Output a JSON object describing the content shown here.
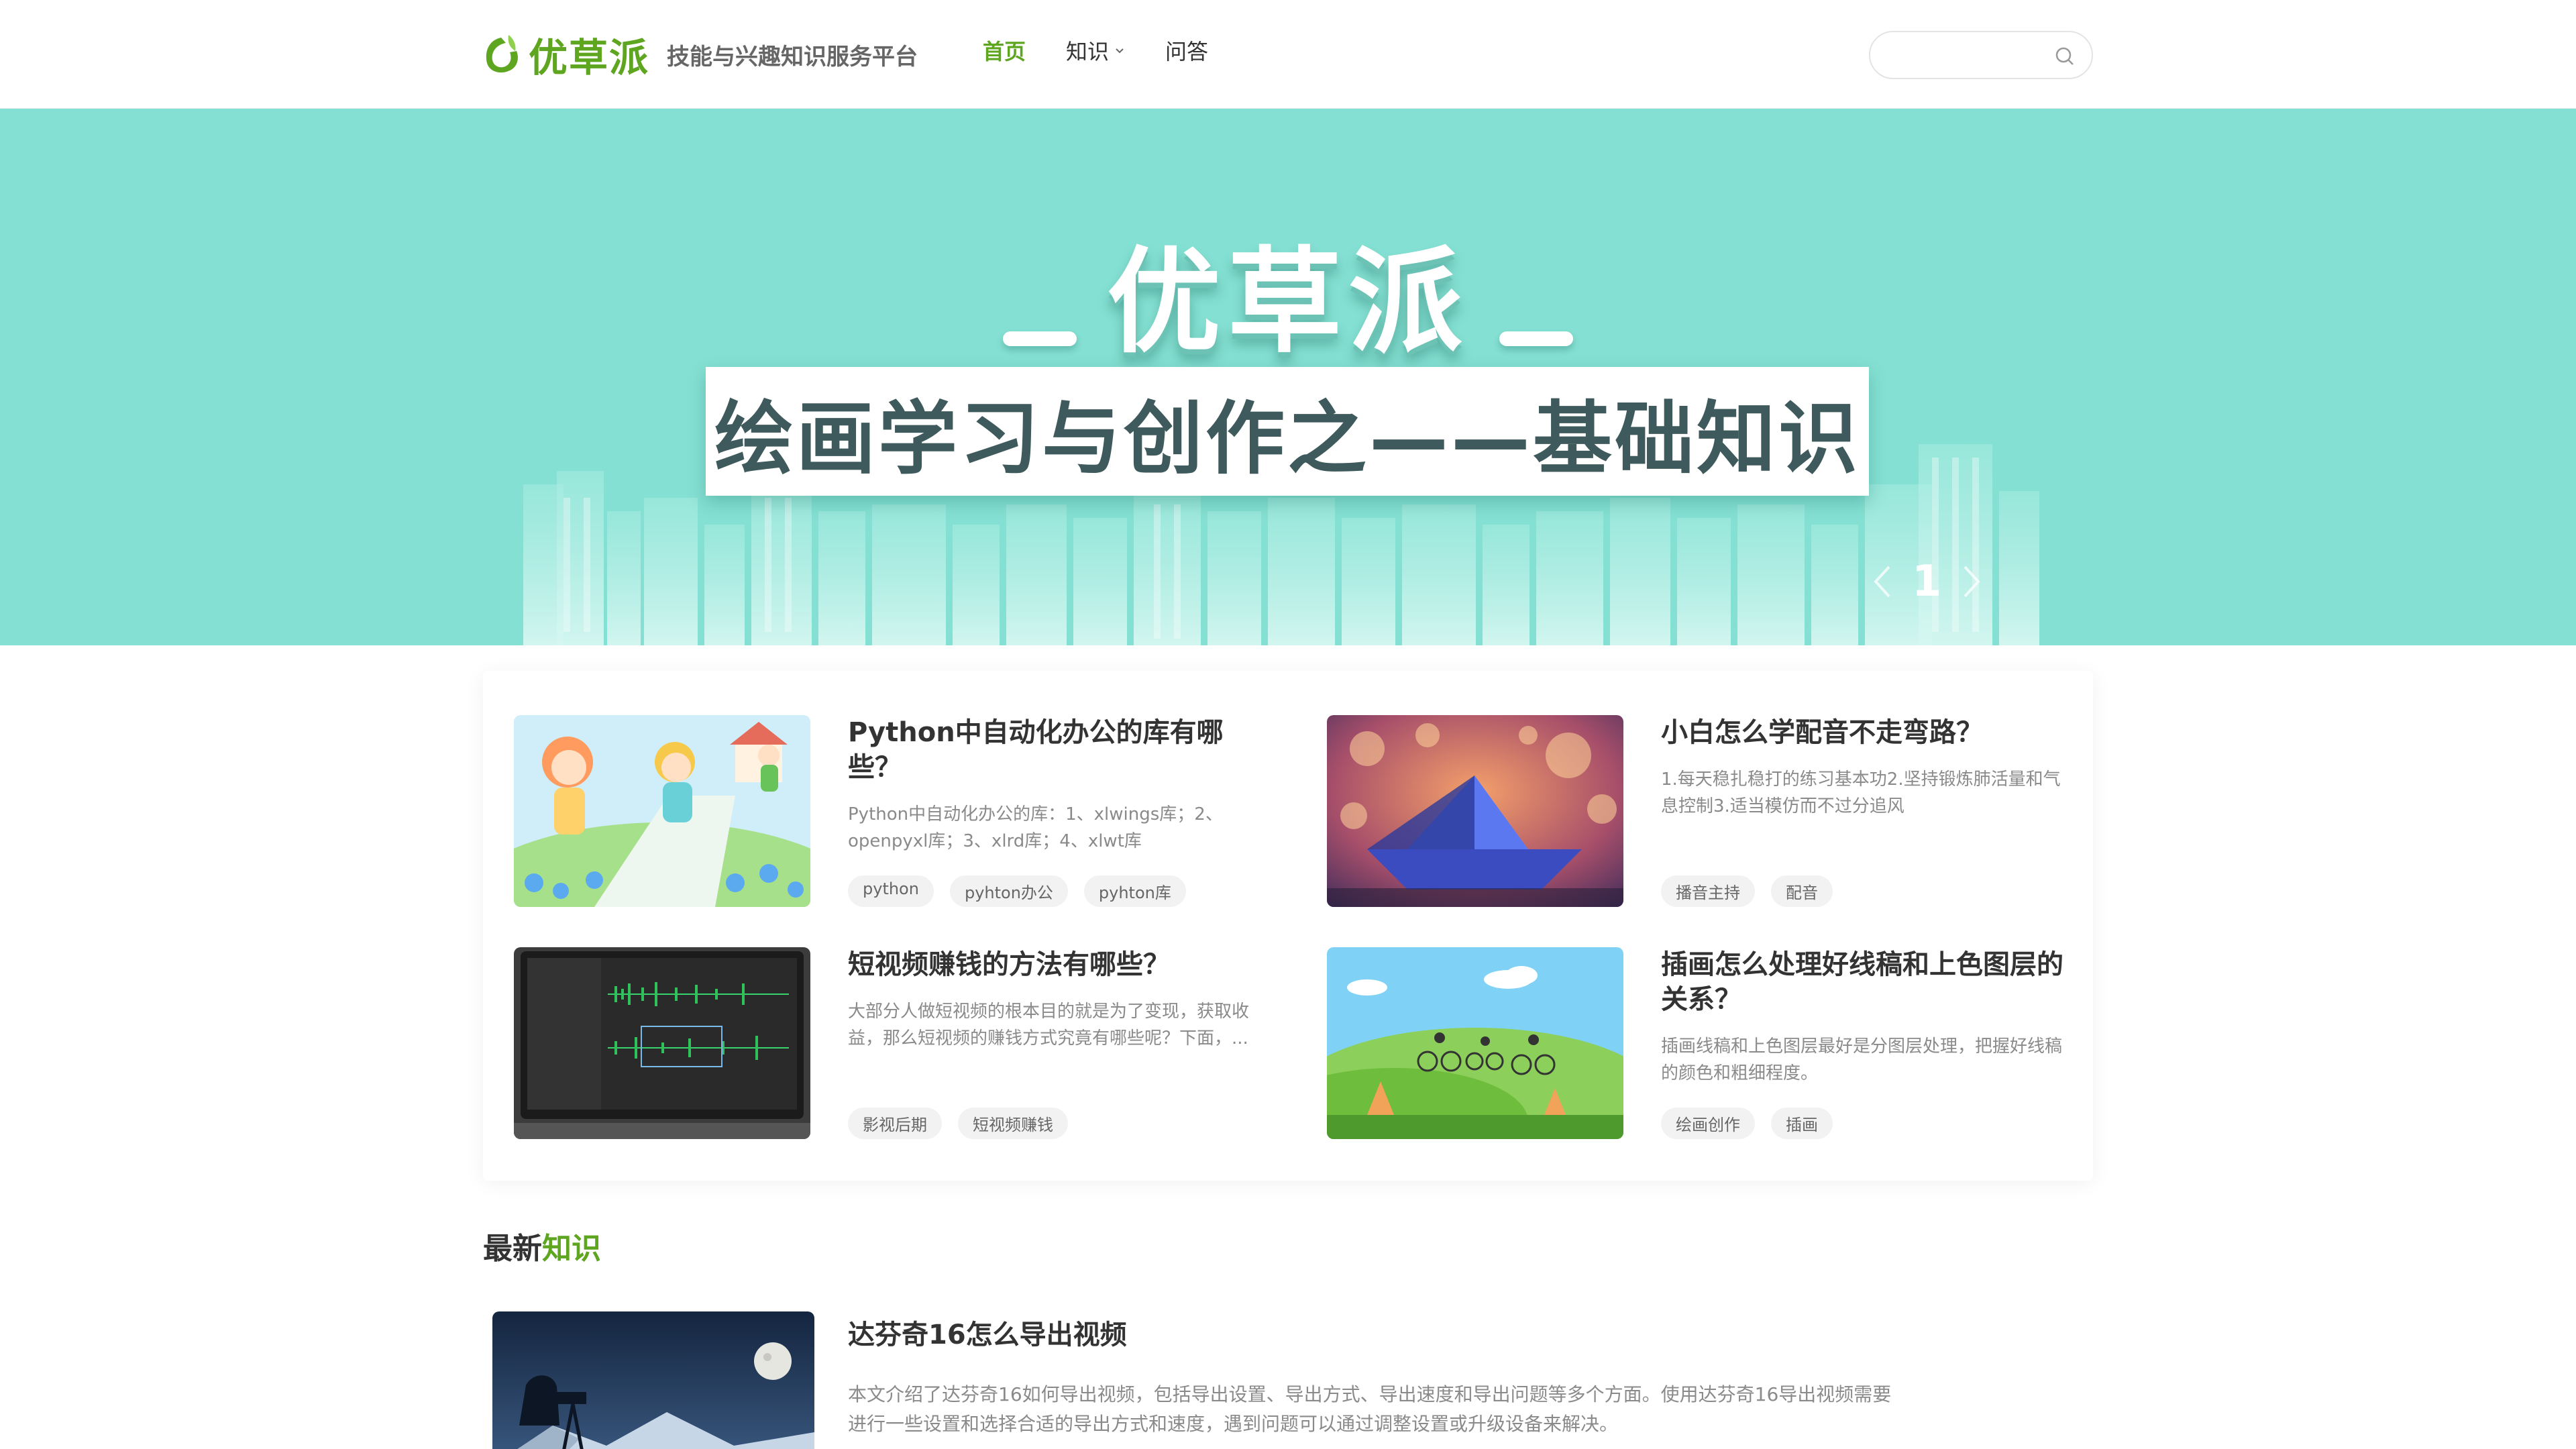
{
  "header": {
    "logo_name": "优草派",
    "slogan": "技能与兴趣知识服务平台",
    "nav": [
      {
        "label": "首页"
      },
      {
        "label": "知识"
      },
      {
        "label": "问答"
      }
    ],
    "search_placeholder": ""
  },
  "banner": {
    "brand": "优草派",
    "headline": "绘画学习与创作之——基础知识",
    "current_slide": "1"
  },
  "featured": [
    {
      "title": "Python中自动化办公的库有哪些？",
      "desc": "Python中自动化办公的库：1、xlwings库；2、openpyxl库；3、xlrd库；4、xlwt库",
      "tags": [
        "python",
        "pyhton办公",
        "pyhton库"
      ]
    },
    {
      "title": "小白怎么学配音不走弯路？",
      "desc": "1.每天稳扎稳打的练习基本功2.坚持锻炼肺活量和气息控制3.适当模仿而不过分追风",
      "tags": [
        "播音主持",
        "配音"
      ]
    },
    {
      "title": "短视频赚钱的方法有哪些？",
      "desc": "大部分人做短视频的根本目的就是为了变现，获取收益，那么短视频的赚钱方式究竟有哪些呢？下面，...",
      "tags": [
        "影视后期",
        "短视频赚钱"
      ]
    },
    {
      "title": "插画怎么处理好线稿和上色图层的关系？",
      "desc": "插画线稿和上色图层最好是分图层处理，把握好线稿的颜色和粗细程度。",
      "tags": [
        "绘画创作",
        "插画"
      ]
    }
  ],
  "latest": {
    "heading_prefix": "最新",
    "heading_accent": "知识",
    "items": [
      {
        "title": "达芬奇16怎么导出视频",
        "desc": "本文介绍了达芬奇16如何导出视频，包括导出设置、导出方式、导出速度和导出问题等多个方面。使用达芬奇16导出视频需要进行一些设置和选择合适的导出方式和速度，遇到问题可以通过调整设置或升级设备来解决。"
      }
    ]
  },
  "colors": {
    "accent": "#5ea520",
    "banner_bg": "#84e0d2",
    "tag_bg": "#f2f2f2"
  }
}
